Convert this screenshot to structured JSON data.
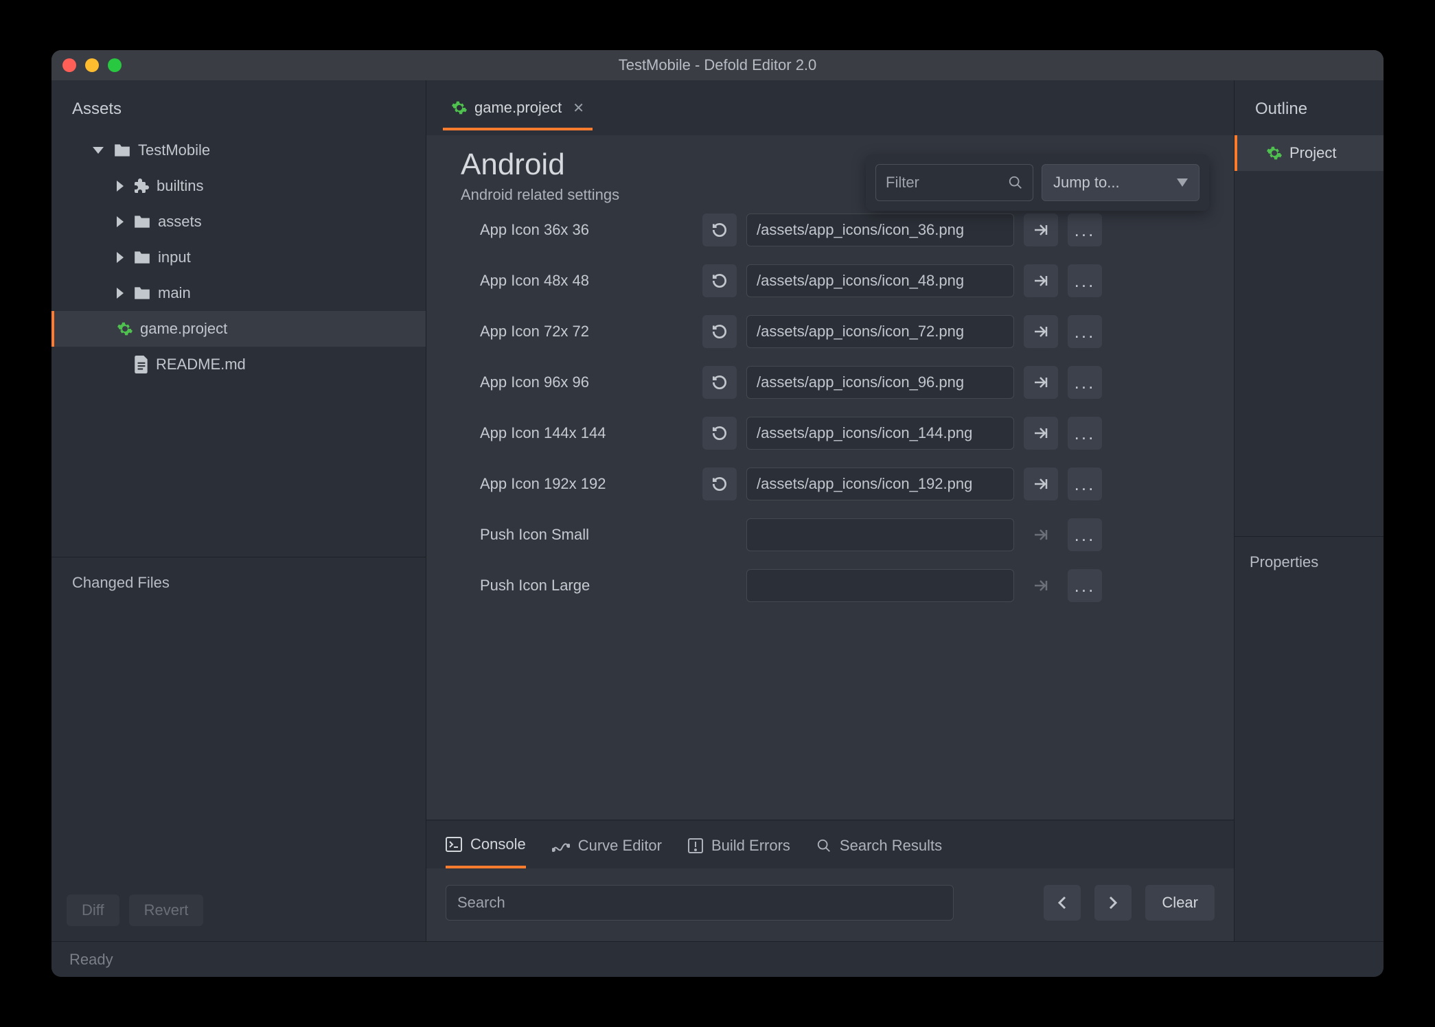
{
  "title": "TestMobile - Defold Editor 2.0",
  "left": {
    "assets_label": "Assets",
    "changed_label": "Changed Files",
    "tree": {
      "root": "TestMobile",
      "folders": [
        "builtins",
        "assets",
        "input",
        "main"
      ],
      "selected_file": "game.project",
      "readme": "README.md"
    },
    "diff_btn": "Diff",
    "revert_btn": "Revert"
  },
  "center": {
    "tab_label": "game.project",
    "section_title": "Android",
    "section_sub": "Android related settings",
    "filter_placeholder": "Filter",
    "jumpto_label": "Jump to...",
    "rows": [
      {
        "label": "App Icon 36x 36",
        "value": "/assets/app_icons/icon_36.png",
        "reset": true
      },
      {
        "label": "App Icon 48x 48",
        "value": "/assets/app_icons/icon_48.png",
        "reset": true
      },
      {
        "label": "App Icon 72x 72",
        "value": "/assets/app_icons/icon_72.png",
        "reset": true
      },
      {
        "label": "App Icon 96x 96",
        "value": "/assets/app_icons/icon_96.png",
        "reset": true
      },
      {
        "label": "App Icon 144x 144",
        "value": "/assets/app_icons/icon_144.png",
        "reset": true
      },
      {
        "label": "App Icon 192x 192",
        "value": "/assets/app_icons/icon_192.png",
        "reset": true
      },
      {
        "label": "Push Icon Small",
        "value": "",
        "reset": false
      },
      {
        "label": "Push Icon Large",
        "value": "",
        "reset": false
      }
    ],
    "bottom_tabs": {
      "console": "Console",
      "curve": "Curve Editor",
      "errors": "Build Errors",
      "search": "Search Results"
    },
    "search_placeholder": "Search",
    "clear_btn": "Clear"
  },
  "right": {
    "outline_label": "Outline",
    "outline_item": "Project",
    "properties_label": "Properties"
  },
  "status": "Ready"
}
